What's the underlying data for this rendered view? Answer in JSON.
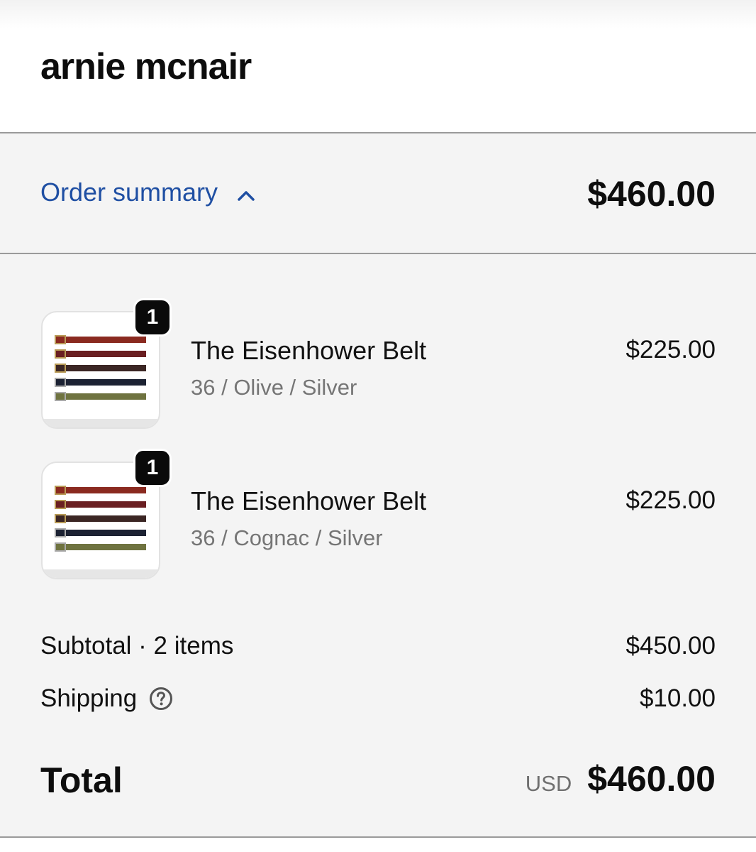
{
  "header": {
    "store_name": "arnie mcnair"
  },
  "summary_toggle": {
    "label": "Order summary",
    "state": "expanded",
    "total": "$460.00",
    "accent_color": "#1f4fa3"
  },
  "line_items": [
    {
      "quantity": "1",
      "name": "The Eisenhower Belt",
      "variant": "36 / Olive / Silver",
      "price": "$225.00",
      "image": "belt-assortment-image"
    },
    {
      "quantity": "1",
      "name": "The Eisenhower Belt",
      "variant": "36 / Cognac / Silver",
      "price": "$225.00",
      "image": "belt-assortment-image"
    }
  ],
  "costs": {
    "subtotal_label": "Subtotal · 2 items",
    "subtotal_value": "$450.00",
    "shipping_label": "Shipping",
    "shipping_value": "$10.00",
    "shipping_icon": "help-icon"
  },
  "total": {
    "label": "Total",
    "currency": "USD",
    "amount": "$460.00"
  }
}
